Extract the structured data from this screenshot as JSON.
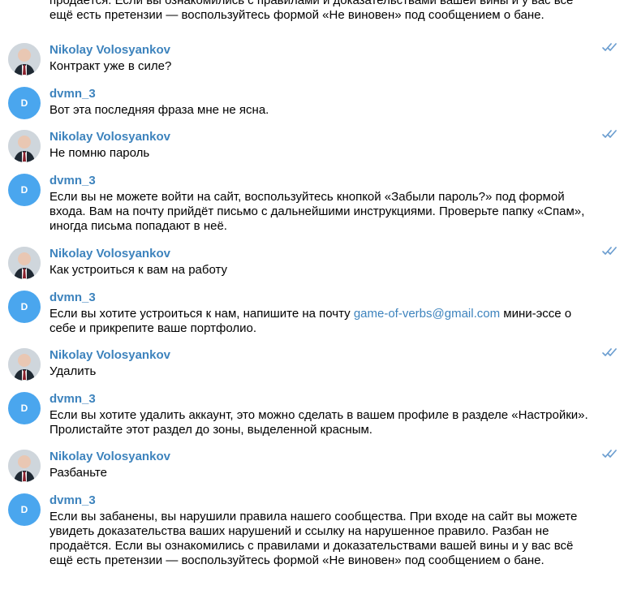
{
  "messages": [
    {
      "kind": "continuation",
      "text_line_1": "продаётся. Если вы ознакомились с правилами и доказательствами вашей вины и у вас всё",
      "text_line_2": "ещё есть претензии — воспользуйтесь формой «Не виновен» под сообщением о бане."
    },
    {
      "sender": "Nikolay Volosyankov",
      "avatar": "photo",
      "status_icon": "double-check-icon",
      "text_line_1": "Контракт уже в силе?"
    },
    {
      "sender": "dvmn_3",
      "avatar": "D",
      "text_line_1": "Вот эта последняя фраза мне не ясна."
    },
    {
      "sender": "Nikolay Volosyankov",
      "avatar": "photo",
      "status_icon": "double-check-icon",
      "text_line_1": "Не помню пароль"
    },
    {
      "sender": "dvmn_3",
      "avatar": "D",
      "text_line_1": "Если вы не можете войти на сайт, воспользуйтесь кнопкой «Забыли пароль?» под формой",
      "text_line_2": "входа. Вам на почту прийдёт письмо с дальнейшими инструкциями. Проверьте папку «Спам»,",
      "text_line_3": "иногда письма попадают в неё."
    },
    {
      "sender": "Nikolay Volosyankov",
      "avatar": "photo",
      "status_icon": "double-check-icon",
      "text_line_1": "Как устроиться к вам на работу"
    },
    {
      "sender": "dvmn_3",
      "avatar": "D",
      "text_line_1_before": "Если вы хотите устроиться к нам, напишите на почту ",
      "link": "game-of-verbs@gmail.com",
      "text_line_1_after": " мини-эссе о",
      "text_line_2": "себе и прикрепите ваше портфолио."
    },
    {
      "sender": "Nikolay Volosyankov",
      "avatar": "photo",
      "status_icon": "double-check-icon",
      "text_line_1": "Удалить"
    },
    {
      "sender": "dvmn_3",
      "avatar": "D",
      "text_line_1": "Если вы хотите удалить аккаунт, это можно сделать в вашем профиле в разделе «Настройки».",
      "text_line_2": "Пролистайте этот раздел до зоны, выделенной красным."
    },
    {
      "sender": "Nikolay Volosyankov",
      "avatar": "photo",
      "status_icon": "double-check-icon",
      "text_line_1": "Разбаньте"
    },
    {
      "sender": "dvmn_3",
      "avatar": "D",
      "text_line_1": "Если вы забанены, вы нарушили правила нашего сообщества. При входе на сайт вы можете",
      "text_line_2": "увидеть доказательства ваших нарушений и ссылку на нарушенное правило. Разбан не",
      "text_line_3": "продаётся. Если вы ознакомились с правилами и доказательствами вашей вины и у вас всё",
      "text_line_4": "ещё есть претензии — воспользуйтесь формой «Не виновен» под сообщением о бане."
    }
  ],
  "colors": {
    "sender": "#3d83bd",
    "link": "#3d83bd",
    "letter_avatar": "#4aa6ee",
    "read_checks": "#6c9ed0"
  }
}
